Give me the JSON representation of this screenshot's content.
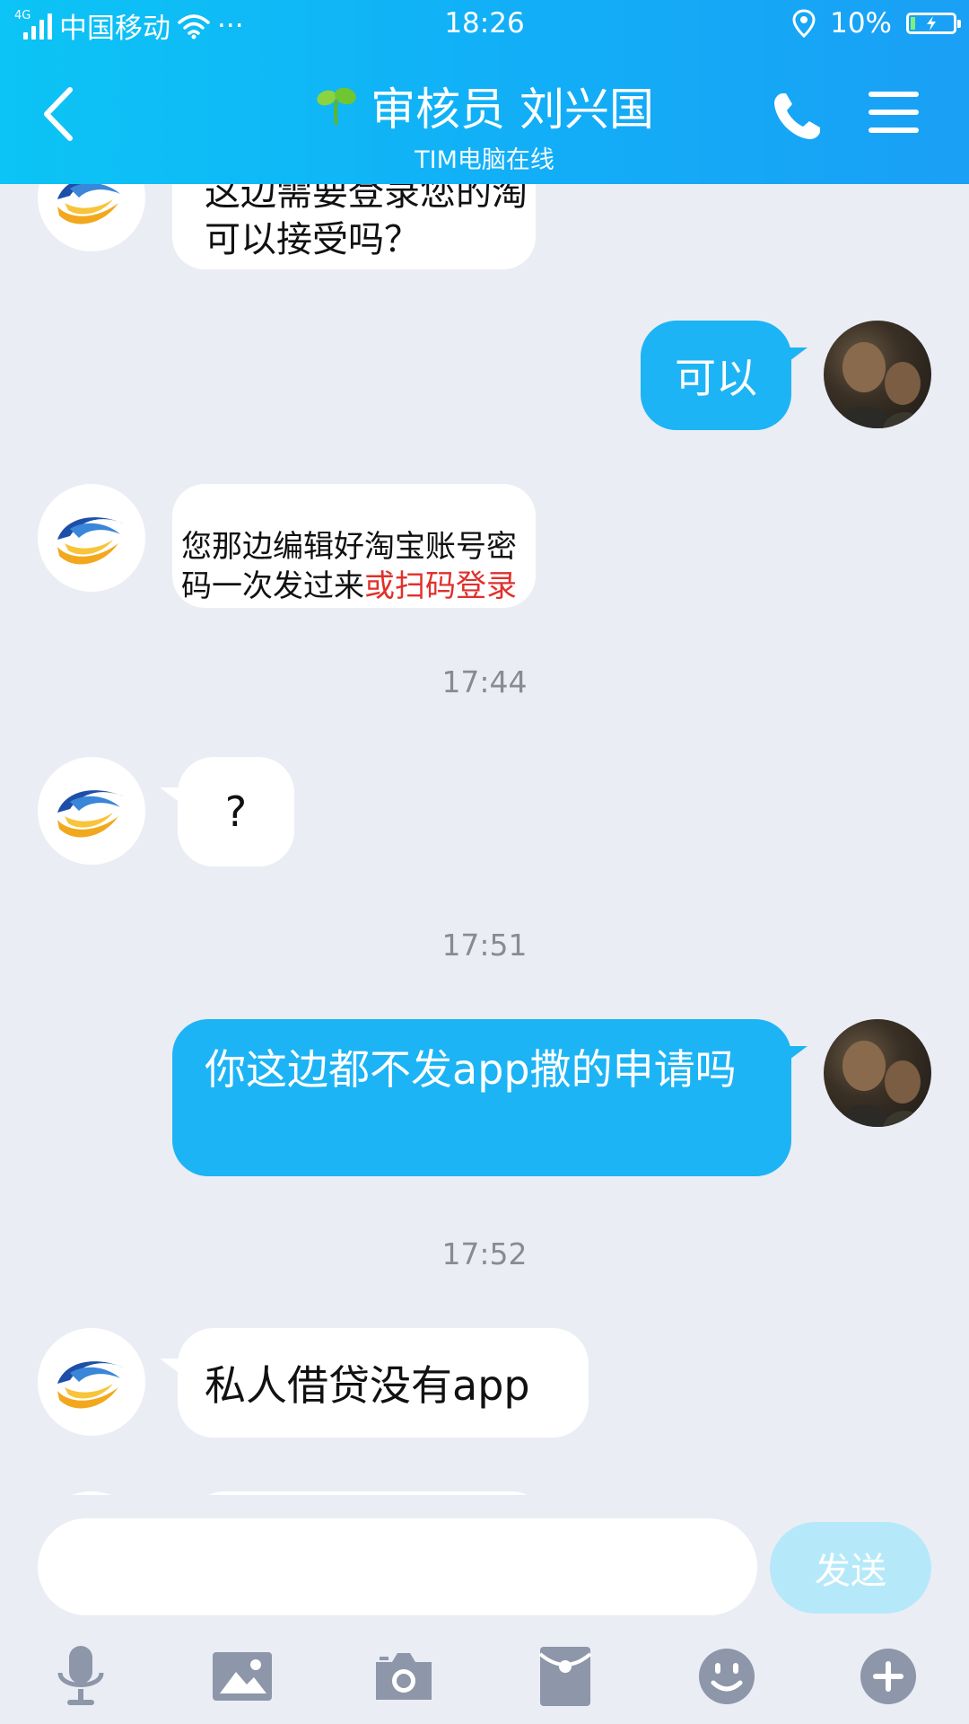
{
  "status_bar": {
    "network_type": "4G",
    "carrier": "中国移动",
    "more": "···",
    "time": "18:26",
    "battery_percent": "10%",
    "battery_level": 0.1
  },
  "header": {
    "title": "审核员 刘兴国",
    "subtitle": "TIM电脑在线"
  },
  "messages": {
    "m1": {
      "line1": "这边需要登录您的淘",
      "line2": "可以接受吗？"
    },
    "m2": {
      "text": "可以"
    },
    "m3": {
      "line1": "您那边编辑好淘宝账号密",
      "line2_black": "码一次发过来",
      "line2_red": "或扫码登录"
    },
    "ts1": "17:44",
    "m4": {
      "text": "?"
    },
    "ts2": "17:51",
    "m5": {
      "text": "你这边都不发app撒的申请吗"
    },
    "ts3": "17:52",
    "m6": {
      "text": "私人借贷没有app"
    }
  },
  "input": {
    "placeholder": "",
    "send_label": "发送"
  },
  "colors": {
    "header_start": "#0cc4f5",
    "header_end": "#1aa0f5",
    "outgoing_bubble": "#1db4f5",
    "incoming_bubble": "#ffffff",
    "chat_background": "#ebedf5",
    "send_disabled": "#b5e9f9",
    "highlight_red": "#e0302c"
  },
  "toolbar_icons": [
    "microphone-icon",
    "image-icon",
    "camera-icon",
    "red-packet-icon",
    "emoji-icon",
    "plus-icon"
  ]
}
